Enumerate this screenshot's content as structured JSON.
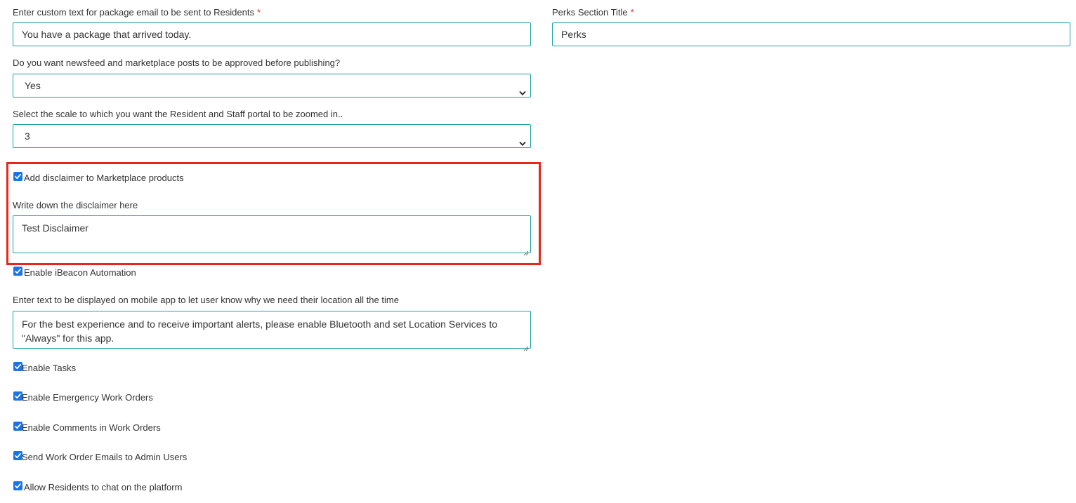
{
  "package_email": {
    "label": "Enter custom text for package email to be sent to Residents",
    "required_mark": "*",
    "value": "You have a package that arrived today."
  },
  "perks_title": {
    "label": "Perks Section Title",
    "required_mark": "*",
    "value": "Perks"
  },
  "approval": {
    "label": "Do you want newsfeed and marketplace posts to be approved before publishing?",
    "value": "Yes"
  },
  "zoom_scale": {
    "label": "Select the scale to which you want the Resident and Staff portal to be zoomed in..",
    "value": "3"
  },
  "disclaimer": {
    "checkbox_label": "Add disclaimer to Marketplace products",
    "checked": true,
    "text_label": "Write down the disclaimer here",
    "value": "Test Disclaimer"
  },
  "ibeacon": {
    "checkbox_label": "Enable iBeacon Automation",
    "checked": true
  },
  "location_text": {
    "label": "Enter text to be displayed on mobile app to let user know why we need their location all the time",
    "value": "For the best experience and to receive important alerts, please enable Bluetooth and set Location Services to \"Always\" for this app."
  },
  "options": [
    {
      "label": "Enable Tasks",
      "checked": true
    },
    {
      "label": "Enable Emergency Work Orders",
      "checked": true
    },
    {
      "label": "Enable Comments in Work Orders",
      "checked": true
    },
    {
      "label": "Send Work Order Emails to Admin Users",
      "checked": true
    },
    {
      "label": "Allow Residents to chat on the platform",
      "checked": true
    }
  ],
  "colors": {
    "field_border": "#1aa3a3",
    "checkbox": "#1a73e8",
    "required": "#e0322f",
    "highlight": "#e8261a"
  },
  "icons": {
    "select_arrow": "chevron-down-icon",
    "checkbox_check": "checkmark-icon"
  }
}
